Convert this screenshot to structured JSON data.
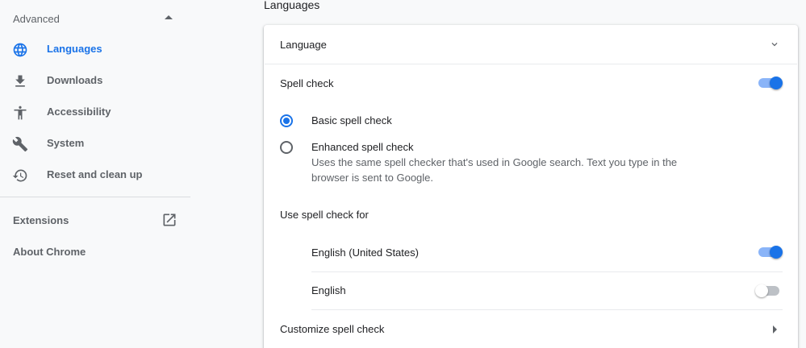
{
  "sidebar": {
    "advanced_label": "Advanced",
    "items": [
      {
        "label": "Languages",
        "icon": "globe-icon",
        "active": true
      },
      {
        "label": "Downloads",
        "icon": "download-icon"
      },
      {
        "label": "Accessibility",
        "icon": "accessibility-icon"
      },
      {
        "label": "System",
        "icon": "wrench-icon"
      },
      {
        "label": "Reset and clean up",
        "icon": "restore-icon"
      }
    ],
    "extensions_label": "Extensions",
    "about_label": "About Chrome"
  },
  "main": {
    "section_title": "Languages",
    "language_row": "Language",
    "spell_check": {
      "label": "Spell check",
      "enabled": true
    },
    "basic": {
      "label": "Basic spell check",
      "selected": true
    },
    "enhanced": {
      "label": "Enhanced spell check",
      "description": "Uses the same spell checker that's used in Google search. Text you type in the browser is sent to Google.",
      "selected": false
    },
    "use_for_label": "Use spell check for",
    "languages": [
      {
        "label": "English (United States)",
        "enabled": true
      },
      {
        "label": "English",
        "enabled": false
      }
    ],
    "customize_label": "Customize spell check"
  },
  "colors": {
    "accent": "#1a73e8",
    "accent_light": "#8ab4f8",
    "text": "#202124",
    "muted": "#5f6368"
  }
}
